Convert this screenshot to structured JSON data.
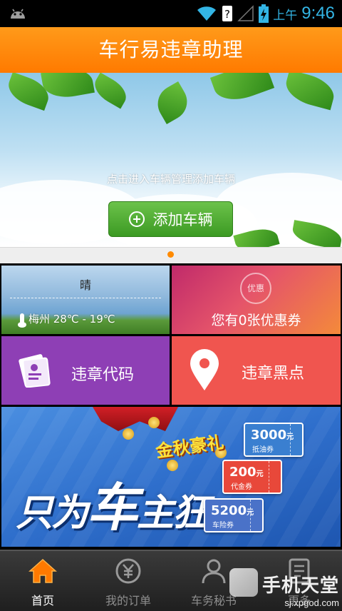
{
  "status_bar": {
    "ampm": "上午",
    "time": "9:46"
  },
  "header": {
    "title": "车行易违章助理"
  },
  "banner": {
    "add_button_label": "添加车辆",
    "hint": "点击进入车辆管理添加车辆"
  },
  "tiles": {
    "weather": {
      "condition": "晴",
      "city_temp": "梅州 28℃ - 19℃"
    },
    "coupon": {
      "badge": "优惠",
      "text": "您有0张优惠券"
    },
    "violation_code": {
      "label": "违章代码"
    },
    "blackspot": {
      "label": "违章黑点"
    }
  },
  "promo": {
    "slogan_a": "只为",
    "slogan_b": "车",
    "slogan_c": "主狂",
    "gift_text": "金秋豪礼",
    "tickets": [
      {
        "amount": "3000",
        "unit": "元",
        "name": "抵油券"
      },
      {
        "amount": "200",
        "unit": "元",
        "name": "代金券"
      },
      {
        "amount": "5200",
        "unit": "元",
        "name": "车险券"
      }
    ]
  },
  "tabbar": {
    "items": [
      {
        "label": "首页",
        "icon": "home-icon",
        "active": true
      },
      {
        "label": "我的订单",
        "icon": "yen-icon",
        "active": false
      },
      {
        "label": "车务秘书",
        "icon": "person-icon",
        "active": false
      },
      {
        "label": "更多",
        "icon": "document-icon",
        "active": false
      }
    ]
  },
  "watermark": {
    "name": "手机天堂",
    "url": "sj.xpgod.com"
  },
  "colors": {
    "accent": "#ff8a00",
    "green_button": "#4caf2f",
    "purple_tile": "#8e3fb5",
    "red_tile": "#f0554f"
  }
}
